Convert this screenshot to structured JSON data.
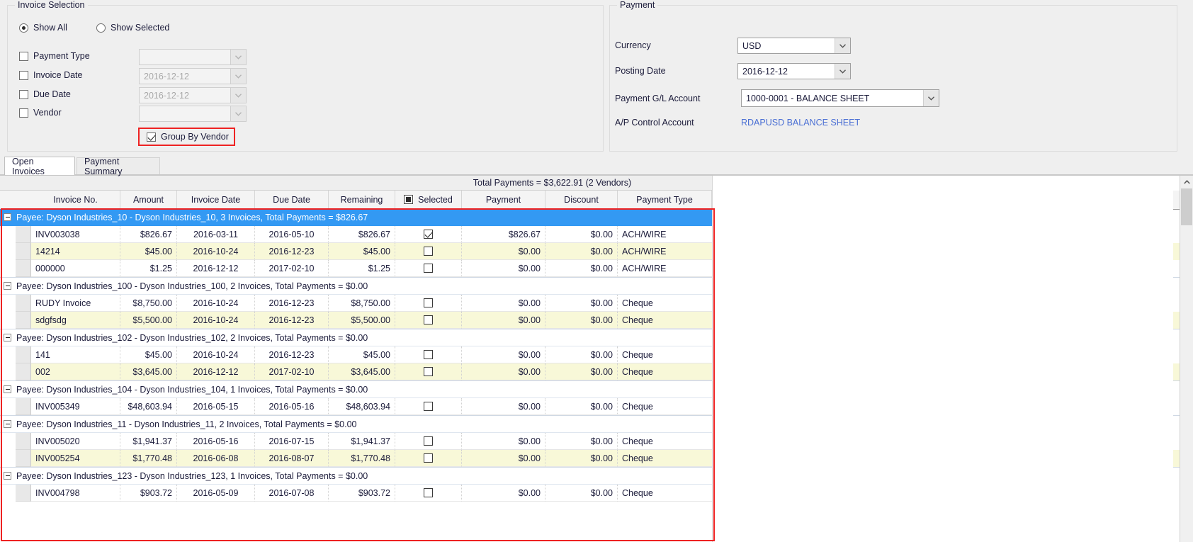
{
  "invoice_selection": {
    "title": "Invoice Selection",
    "radios": [
      {
        "label": "Show All",
        "checked": true
      },
      {
        "label": "Show Selected",
        "checked": false
      }
    ],
    "filters": [
      {
        "label": "Payment Type",
        "checked": false,
        "value": "",
        "enabled": false
      },
      {
        "label": "Invoice Date",
        "checked": false,
        "value": "2016-12-12",
        "enabled": false
      },
      {
        "label": "Due Date",
        "checked": false,
        "value": "2016-12-12",
        "enabled": false
      },
      {
        "label": "Vendor",
        "checked": false,
        "value": "",
        "enabled": false
      }
    ],
    "group_by_vendor": {
      "label": "Group By Vendor",
      "checked": true
    }
  },
  "payment": {
    "title": "Payment",
    "currency_label": "Currency",
    "currency_value": "USD",
    "posting_date_label": "Posting Date",
    "posting_date_value": "2016-12-12",
    "gl_account_label": "Payment G/L Account",
    "gl_account_value": "1000-0001 - BALANCE SHEET",
    "ap_control_label": "A/P Control Account",
    "ap_control_value": "RDAPUSD BALANCE SHEET",
    "link_color": "#4a6fd4"
  },
  "tabs": [
    {
      "label": "Open Invoices",
      "active": true
    },
    {
      "label": "Payment Summary",
      "active": false
    }
  ],
  "grid": {
    "total_bar": "Total Payments = $3,622.91 (2 Vendors)",
    "columns": [
      "Invoice No.",
      "Amount",
      "Invoice Date",
      "Due Date",
      "Remaining",
      "Selected",
      "Payment",
      "Discount",
      "Payment Type"
    ],
    "select_all_state": "indeterminate",
    "groups": [
      {
        "header": "Payee: Dyson Industries_10 - Dyson Industries_10, 3 Invoices, Total Payments = $826.67",
        "selected": true,
        "rows": [
          {
            "invoice_no": "INV003038",
            "amount": "$826.67",
            "invoice_date": "2016-03-11",
            "due_date": "2016-05-10",
            "remaining": "$826.67",
            "selected": true,
            "payment": "$826.67",
            "discount": "$0.00",
            "payment_type": "ACH/WIRE",
            "alt": false
          },
          {
            "invoice_no": "14214",
            "amount": "$45.00",
            "invoice_date": "2016-10-24",
            "due_date": "2016-12-23",
            "remaining": "$45.00",
            "selected": false,
            "payment": "$0.00",
            "discount": "$0.00",
            "payment_type": "ACH/WIRE",
            "alt": true
          },
          {
            "invoice_no": "000000",
            "amount": "$1.25",
            "invoice_date": "2016-12-12",
            "due_date": "2017-02-10",
            "remaining": "$1.25",
            "selected": false,
            "payment": "$0.00",
            "discount": "$0.00",
            "payment_type": "ACH/WIRE",
            "alt": false
          }
        ]
      },
      {
        "header": "Payee: Dyson Industries_100 - Dyson Industries_100, 2 Invoices, Total Payments = $0.00",
        "selected": false,
        "rows": [
          {
            "invoice_no": "RUDY Invoice",
            "amount": "$8,750.00",
            "invoice_date": "2016-10-24",
            "due_date": "2016-12-23",
            "remaining": "$8,750.00",
            "selected": false,
            "payment": "$0.00",
            "discount": "$0.00",
            "payment_type": "Cheque",
            "alt": false
          },
          {
            "invoice_no": "sdgfsdg",
            "amount": "$5,500.00",
            "invoice_date": "2016-10-24",
            "due_date": "2016-12-23",
            "remaining": "$5,500.00",
            "selected": false,
            "payment": "$0.00",
            "discount": "$0.00",
            "payment_type": "Cheque",
            "alt": true
          }
        ]
      },
      {
        "header": "Payee: Dyson Industries_102 - Dyson Industries_102, 2 Invoices, Total Payments = $0.00",
        "selected": false,
        "rows": [
          {
            "invoice_no": "141",
            "amount": "$45.00",
            "invoice_date": "2016-10-24",
            "due_date": "2016-12-23",
            "remaining": "$45.00",
            "selected": false,
            "payment": "$0.00",
            "discount": "$0.00",
            "payment_type": "Cheque",
            "alt": false
          },
          {
            "invoice_no": "002",
            "amount": "$3,645.00",
            "invoice_date": "2016-12-12",
            "due_date": "2017-02-10",
            "remaining": "$3,645.00",
            "selected": false,
            "payment": "$0.00",
            "discount": "$0.00",
            "payment_type": "Cheque",
            "alt": true
          }
        ]
      },
      {
        "header": "Payee: Dyson Industries_104 - Dyson Industries_104, 1 Invoices, Total Payments = $0.00",
        "selected": false,
        "rows": [
          {
            "invoice_no": "INV005349",
            "amount": "$48,603.94",
            "invoice_date": "2016-05-15",
            "due_date": "2016-05-16",
            "remaining": "$48,603.94",
            "selected": false,
            "payment": "$0.00",
            "discount": "$0.00",
            "payment_type": "Cheque",
            "alt": false
          }
        ]
      },
      {
        "header": "Payee: Dyson Industries_11 - Dyson Industries_11, 2 Invoices, Total Payments = $0.00",
        "selected": false,
        "rows": [
          {
            "invoice_no": "INV005020",
            "amount": "$1,941.37",
            "invoice_date": "2016-05-16",
            "due_date": "2016-07-15",
            "remaining": "$1,941.37",
            "selected": false,
            "payment": "$0.00",
            "discount": "$0.00",
            "payment_type": "Cheque",
            "alt": false
          },
          {
            "invoice_no": "INV005254",
            "amount": "$1,770.48",
            "invoice_date": "2016-06-08",
            "due_date": "2016-08-07",
            "remaining": "$1,770.48",
            "selected": false,
            "payment": "$0.00",
            "discount": "$0.00",
            "payment_type": "Cheque",
            "alt": true
          }
        ]
      },
      {
        "header": "Payee: Dyson Industries_123 - Dyson Industries_123, 1 Invoices, Total Payments = $0.00",
        "selected": false,
        "rows": [
          {
            "invoice_no": "INV004798",
            "amount": "$903.72",
            "invoice_date": "2016-05-09",
            "due_date": "2016-07-08",
            "remaining": "$903.72",
            "selected": false,
            "payment": "$0.00",
            "discount": "$0.00",
            "payment_type": "Cheque",
            "alt": false
          }
        ]
      }
    ]
  },
  "highlight_color": "#ee2222",
  "selection_color": "#3399f3"
}
